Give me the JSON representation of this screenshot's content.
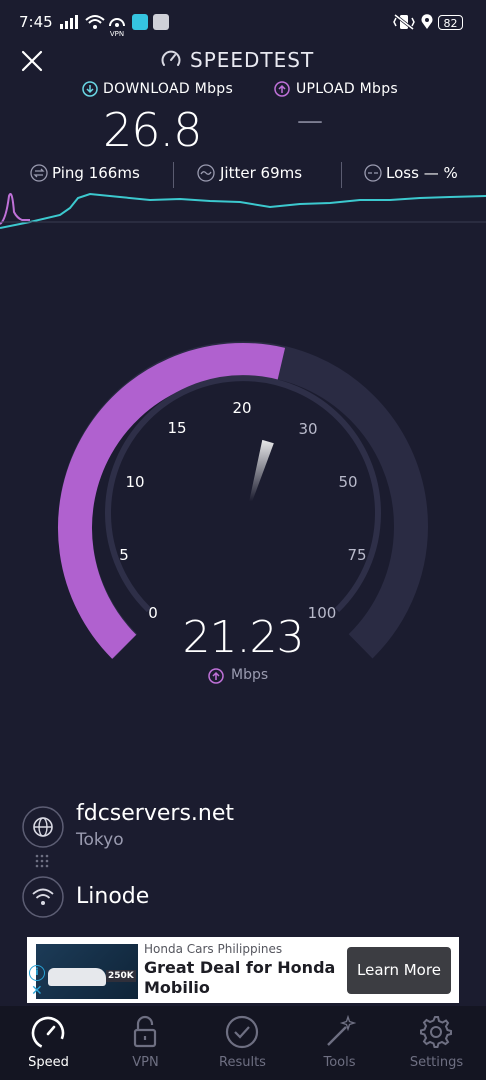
{
  "status_bar": {
    "time": "7:45",
    "vpn_label": "VPN",
    "battery": "82"
  },
  "header": {
    "title": "SPEEDTEST"
  },
  "metrics": {
    "download_label": "DOWNLOAD Mbps",
    "download_value": "26.8",
    "upload_label": "UPLOAD Mbps",
    "upload_value": "—"
  },
  "stats": {
    "ping_label": "Ping",
    "ping_value": "166ms",
    "jitter_label": "Jitter",
    "jitter_value": "69ms",
    "loss_label": "Loss",
    "loss_value": "—",
    "loss_unit": "%"
  },
  "gauge": {
    "ticks": [
      "0",
      "5",
      "10",
      "15",
      "20",
      "30",
      "50",
      "75",
      "100"
    ],
    "current_value": "21.23",
    "unit": "Mbps",
    "mode": "upload",
    "current_mbps": 21.23
  },
  "server": {
    "host": "fdcservers.net",
    "location": "Tokyo",
    "provider": "Linode"
  },
  "ad": {
    "advertiser": "Honda Cars Philippines",
    "headline_line1": "Great Deal for Honda",
    "headline_line2": "Mobilio",
    "cta": "Learn More",
    "image_price": "250K"
  },
  "nav": {
    "items": [
      {
        "label": "Speed",
        "icon": "speedometer-icon",
        "active": true
      },
      {
        "label": "VPN",
        "icon": "lock-icon",
        "active": false
      },
      {
        "label": "Results",
        "icon": "checkmark-circle-icon",
        "active": false
      },
      {
        "label": "Tools",
        "icon": "magic-wand-icon",
        "active": false
      },
      {
        "label": "Settings",
        "icon": "gear-icon",
        "active": false
      }
    ]
  },
  "colors": {
    "background": "#1b1c2f",
    "download_accent": "#6ad7e5",
    "upload_accent": "#bf71d8",
    "graph_line": "#3cc9cf"
  }
}
